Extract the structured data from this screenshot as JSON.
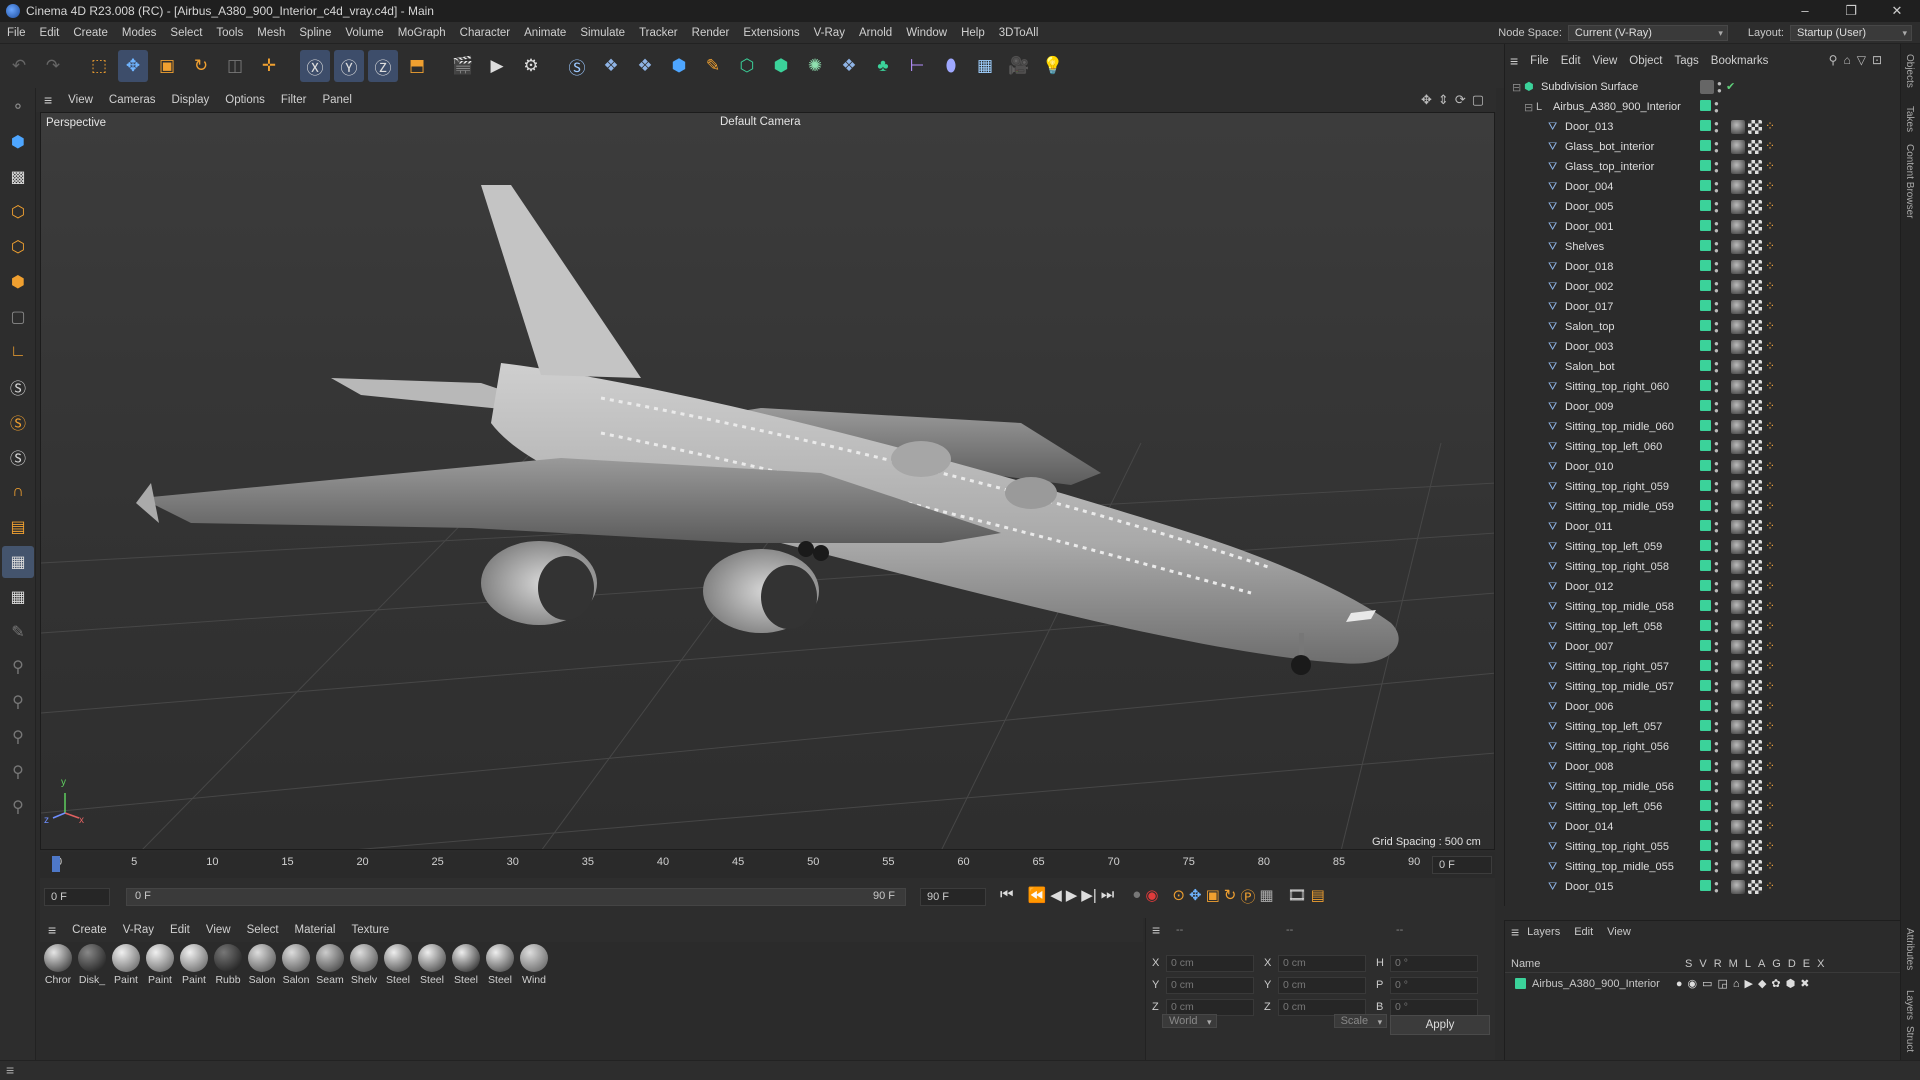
{
  "window": {
    "title": "Cinema 4D R23.008 (RC) - [Airbus_A380_900_Interior_c4d_vray.c4d] - Main",
    "min": "–",
    "max": "❐",
    "close": "✕"
  },
  "menu": [
    "File",
    "Edit",
    "Create",
    "Modes",
    "Select",
    "Tools",
    "Mesh",
    "Spline",
    "Volume",
    "MoGraph",
    "Character",
    "Animate",
    "Simulate",
    "Tracker",
    "Render",
    "Extensions",
    "V-Ray",
    "Arnold",
    "Window",
    "Help",
    "3DToAll"
  ],
  "node_space": {
    "label": "Node Space:",
    "value": "Current (V-Ray)"
  },
  "layout": {
    "label": "Layout:",
    "value": "Startup (User)"
  },
  "viewport": {
    "menu": [
      "View",
      "Cameras",
      "Display",
      "Options",
      "Filter",
      "Panel"
    ],
    "name": "Perspective",
    "camera": "Default Camera",
    "grid_spacing": "Grid Spacing : 500 cm",
    "axis": {
      "y": "y",
      "z": "z",
      "x": "x"
    }
  },
  "timeline": {
    "ticks": [
      "0",
      "5",
      "10",
      "15",
      "20",
      "25",
      "30",
      "35",
      "40",
      "45",
      "50",
      "55",
      "60",
      "65",
      "70",
      "75",
      "80",
      "85",
      "90"
    ],
    "current_frame_right": "0 F",
    "start": "0 F",
    "range_start": "0 F",
    "range_end": "90 F",
    "end": "90 F"
  },
  "material_menu": [
    "Create",
    "V-Ray",
    "Edit",
    "View",
    "Select",
    "Material",
    "Texture"
  ],
  "materials": [
    {
      "name": "Chror",
      "c1": "#e6e6e6",
      "c2": "#222"
    },
    {
      "name": "Disk_",
      "c1": "#888",
      "c2": "#111"
    },
    {
      "name": "Paint",
      "c1": "#f0f0f0",
      "c2": "#555"
    },
    {
      "name": "Paint",
      "c1": "#f0f0f0",
      "c2": "#555"
    },
    {
      "name": "Paint",
      "c1": "#f0f0f0",
      "c2": "#555"
    },
    {
      "name": "Rubb",
      "c1": "#777",
      "c2": "#111"
    },
    {
      "name": "Salon",
      "c1": "#ddd",
      "c2": "#444"
    },
    {
      "name": "Salon",
      "c1": "#ddd",
      "c2": "#444"
    },
    {
      "name": "Seam",
      "c1": "#ccc",
      "c2": "#333"
    },
    {
      "name": "Shelv",
      "c1": "#ddd",
      "c2": "#444"
    },
    {
      "name": "Steel",
      "c1": "#eee",
      "c2": "#333"
    },
    {
      "name": "Steel",
      "c1": "#eee",
      "c2": "#333"
    },
    {
      "name": "Steel",
      "c1": "#eee",
      "c2": "#111"
    },
    {
      "name": "Steel",
      "c1": "#eee",
      "c2": "#333"
    },
    {
      "name": "Wind",
      "c1": "#ddd",
      "c2": "#555"
    }
  ],
  "coords": {
    "dash1": "--",
    "dash2": "--",
    "dash3": "--",
    "rows": [
      {
        "a": "X",
        "av": "0 cm",
        "b": "X",
        "bv": "0 cm",
        "c": "H",
        "cv": "0 °"
      },
      {
        "a": "Y",
        "av": "0 cm",
        "b": "Y",
        "bv": "0 cm",
        "c": "P",
        "cv": "0 °"
      },
      {
        "a": "Z",
        "av": "0 cm",
        "b": "Z",
        "bv": "0 cm",
        "c": "B",
        "cv": "0 °"
      }
    ],
    "mode": "World",
    "scale": "Scale",
    "apply": "Apply"
  },
  "object_manager": {
    "menu": [
      "File",
      "Edit",
      "View",
      "Object",
      "Tags",
      "Bookmarks"
    ],
    "root": "Subdivision Surface",
    "group": "Airbus_A380_900_Interior",
    "objects": [
      "Door_013",
      "Glass_bot_interior",
      "Glass_top_interior",
      "Door_004",
      "Door_005",
      "Door_001",
      "Shelves",
      "Door_018",
      "Door_002",
      "Door_017",
      "Salon_top",
      "Door_003",
      "Salon_bot",
      "Sitting_top_right_060",
      "Door_009",
      "Sitting_top_midle_060",
      "Sitting_top_left_060",
      "Door_010",
      "Sitting_top_right_059",
      "Sitting_top_midle_059",
      "Door_011",
      "Sitting_top_left_059",
      "Sitting_top_right_058",
      "Door_012",
      "Sitting_top_midle_058",
      "Sitting_top_left_058",
      "Door_007",
      "Sitting_top_right_057",
      "Sitting_top_midle_057",
      "Door_006",
      "Sitting_top_left_057",
      "Sitting_top_right_056",
      "Door_008",
      "Sitting_top_midle_056",
      "Sitting_top_left_056",
      "Door_014",
      "Sitting_top_right_055",
      "Sitting_top_midle_055",
      "Door_015"
    ]
  },
  "layers": {
    "menu": [
      "Layers",
      "Edit",
      "View"
    ],
    "header_name": "Name",
    "header_cols": [
      "S",
      "V",
      "R",
      "M",
      "L",
      "A",
      "G",
      "D",
      "E",
      "X"
    ],
    "row": "Airbus_A380_900_Interior"
  },
  "right_tabs": [
    "Objects",
    "Takes",
    "Content Browser",
    "Attributes",
    "Layers",
    "Struct"
  ],
  "colors": {
    "accent": "#3d4d6a",
    "layer_green": "#3bd29a",
    "tag_orange": "#f2a23a"
  }
}
